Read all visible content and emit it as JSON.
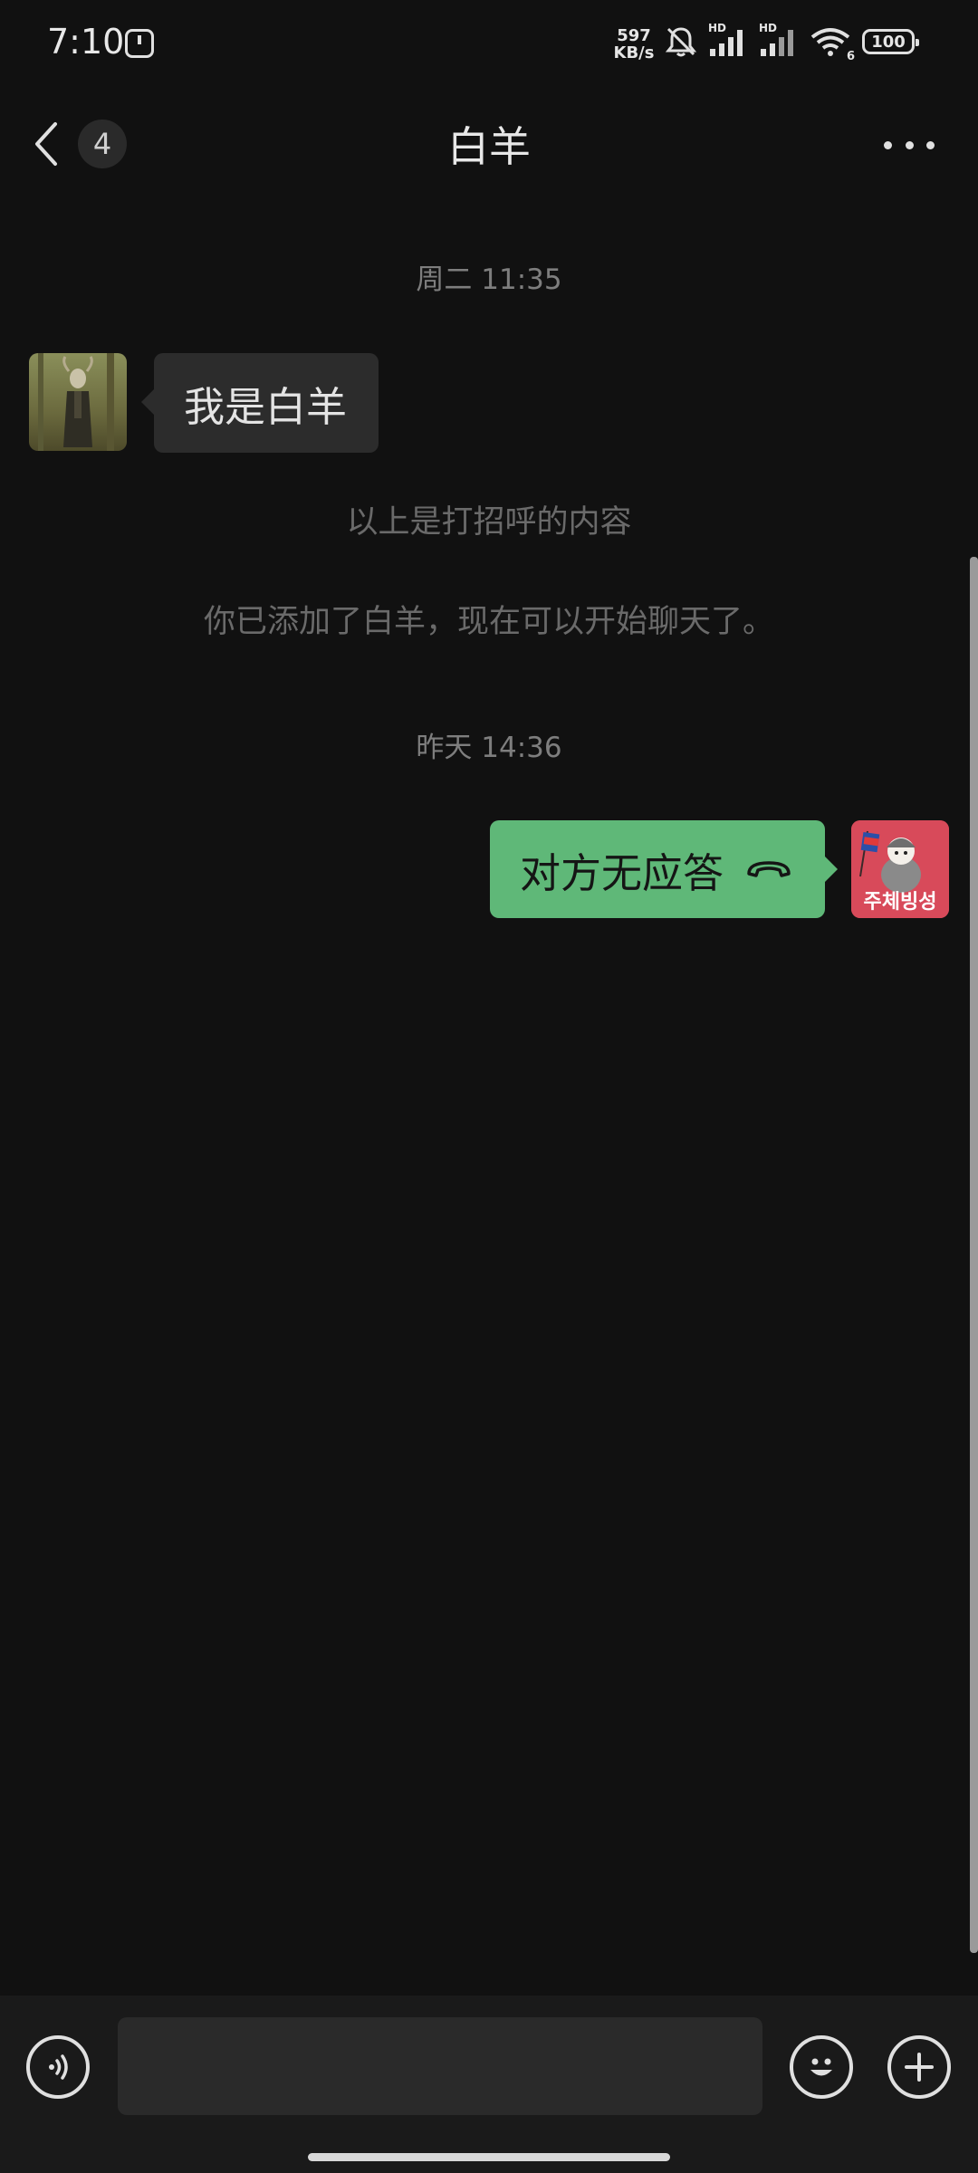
{
  "status_bar": {
    "time": "7:10",
    "net_speed_value": "597",
    "net_speed_unit": "KB/s",
    "hd_label": "HD",
    "wifi_label": "6",
    "battery": "100"
  },
  "header": {
    "back_icon": "chevron-left-icon",
    "unread_count": "4",
    "title": "白羊",
    "more_icon": "more-horizontal-icon"
  },
  "messages": {
    "timestamp_1": "周二 11:35",
    "received": {
      "text": "我是白羊"
    },
    "notice_1": "以上是打招呼的内容",
    "notice_2": "你已添加了白羊，现在可以开始聊天了。",
    "timestamp_2": "昨天 14:36",
    "sent": {
      "text": "对方无应答",
      "icon": "phone-hangup-icon"
    },
    "sent_avatar_caption": "주체빙성"
  },
  "input_bar": {
    "voice_icon": "voice-icon",
    "message_value": "",
    "emoji_icon": "emoji-icon",
    "plus_icon": "plus-icon"
  },
  "colors": {
    "background": "#111111",
    "sent_bubble": "#5fb878",
    "received_bubble": "#2c2c2c",
    "avatar_red": "#d84a5a"
  }
}
